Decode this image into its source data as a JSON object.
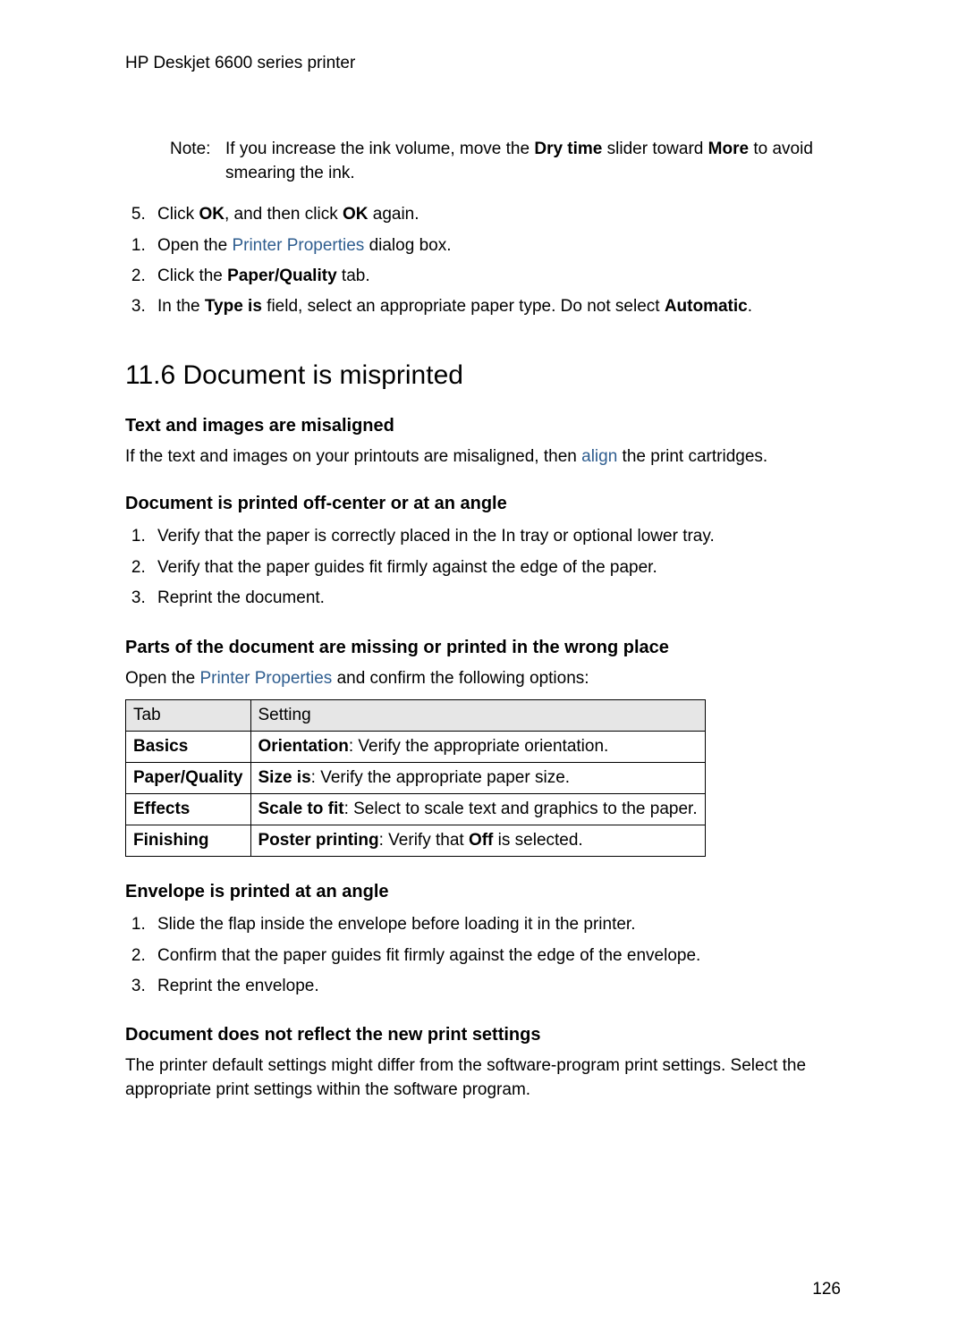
{
  "header": "HP Deskjet 6600 series printer",
  "note": {
    "label": "Note:",
    "text_prefix": "If you increase the ink volume, move the ",
    "bold1": "Dry time",
    "text_mid": " slider toward ",
    "bold2": "More",
    "text_suffix": " to avoid smearing the ink."
  },
  "steps_top": {
    "s5_prefix": "Click ",
    "s5_b1": "OK",
    "s5_mid": ", and then click ",
    "s5_b2": "OK",
    "s5_suffix": " again.",
    "s1_prefix": "Open the ",
    "s1_link": "Printer Properties",
    "s1_suffix": " dialog box.",
    "s2_prefix": "Click the ",
    "s2_b": "Paper/Quality",
    "s2_suffix": " tab.",
    "s3_prefix": "In the ",
    "s3_b1": "Type is",
    "s3_mid": " field, select an appropriate paper type. Do not select ",
    "s3_b2": "Automatic",
    "s3_suffix": "."
  },
  "section_title": "11.6  Document is misprinted",
  "sub1": {
    "title": "Text and images are misaligned",
    "text_prefix": "If the text and images on your printouts are misaligned, then ",
    "link": "align",
    "text_suffix": " the print cartridges."
  },
  "sub2": {
    "title": "Document is printed off-center or at an angle",
    "s1": "Verify that the paper is correctly placed in the In tray or optional lower tray.",
    "s2": "Verify that the paper guides fit firmly against the edge of the paper.",
    "s3": "Reprint the document."
  },
  "sub3": {
    "title": "Parts of the document are missing or printed in the wrong place",
    "text_prefix": "Open the ",
    "link": "Printer Properties",
    "text_suffix": " and confirm the following options:"
  },
  "table": {
    "h1": "Tab",
    "h2": "Setting",
    "r1c1": "Basics",
    "r1c2_b": "Orientation",
    "r1c2_t": ": Verify the appropriate orientation.",
    "r2c1": "Paper/Quality",
    "r2c2_b": "Size is",
    "r2c2_t": ": Verify the appropriate paper size.",
    "r3c1": "Effects",
    "r3c2_b": "Scale to fit",
    "r3c2_t": ": Select to scale text and graphics to the paper.",
    "r4c1": "Finishing",
    "r4c2_b": "Poster printing",
    "r4c2_t1": ": Verify that ",
    "r4c2_b2": "Off",
    "r4c2_t2": " is selected."
  },
  "sub4": {
    "title": "Envelope is printed at an angle",
    "s1": "Slide the flap inside the envelope before loading it in the printer.",
    "s2": "Confirm that the paper guides fit firmly against the edge of the envelope.",
    "s3": "Reprint the envelope."
  },
  "sub5": {
    "title": "Document does not reflect the new print settings",
    "text": "The printer default settings might differ from the software-program print settings. Select the appropriate print settings within the software program."
  },
  "page_number": "126"
}
